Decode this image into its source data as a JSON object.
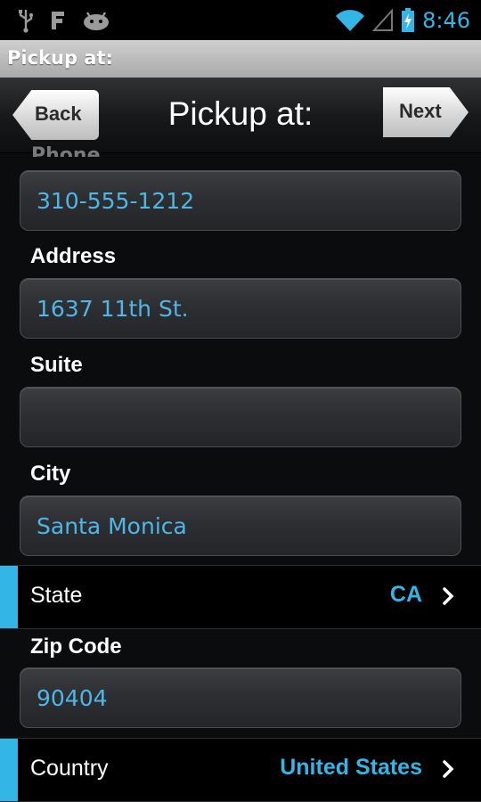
{
  "status_bar": {
    "time": "8:46",
    "icons": [
      "usb-icon",
      "f-app-icon",
      "android-icon",
      "wifi-icon",
      "signal-icon",
      "battery-charging-icon"
    ]
  },
  "title_strip": {
    "title": "Pickup at:"
  },
  "nav": {
    "title": "Pickup at:",
    "back_label": "Back",
    "next_label": "Next"
  },
  "form": {
    "phone": {
      "label": "Phone",
      "value": "310-555-1212"
    },
    "address": {
      "label": "Address",
      "value": "1637 11th St."
    },
    "suite": {
      "label": "Suite",
      "value": ""
    },
    "city": {
      "label": "City",
      "value": "Santa Monica"
    },
    "state": {
      "label": "State",
      "value": "CA"
    },
    "zip": {
      "label": "Zip Code",
      "value": "90404"
    },
    "country": {
      "label": "Country",
      "value": "United States"
    }
  },
  "colors": {
    "accent": "#33b5e5",
    "field_text": "#4fb6e6",
    "background": "#0b0c0e"
  }
}
